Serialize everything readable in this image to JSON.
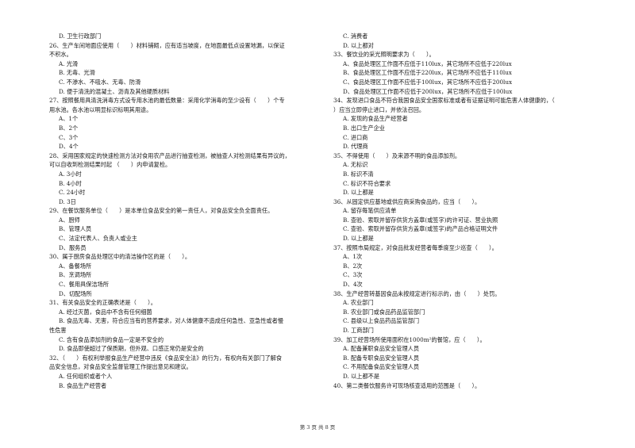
{
  "page": {
    "footer": "第 3 页 共 8 页"
  },
  "left_column": {
    "leading_option": "D. 卫生行政部门",
    "questions": [
      {
        "number": "26",
        "stem_lines": [
          "26、生产车间地面应使用（　　）材料铺砌，应有适当坡度，在地面最低点设置地漏，以保证",
          "不积水。"
        ],
        "options": [
          "A. 光滑",
          "B. 无毒、光滑",
          "C. 不渗水、不吸水、无毒、防滑",
          "D. 便于清洗的混凝土、沥青及其他硬质材料"
        ]
      },
      {
        "number": "27",
        "stem_lines": [
          "27、按照餐用具清洗消毒方式设专用水池的最低数量：采用化学消毒的至少设有（　　）个专",
          "用水池。各水池以明显标识标明其用途。"
        ],
        "options": [
          "A、1个",
          "B、2个",
          "C、3个",
          "D、4个"
        ]
      },
      {
        "number": "28",
        "stem_lines": [
          "28、采用国家规定的快速检测方法对食用农产品进行抽查检测，被抽查人对检测结果有异议的，",
          "可以自收到检测结果时起 （　　）内申请复检。"
        ],
        "options": [
          "A. 3小时",
          "B. 4小时",
          "C. 24小时",
          "D. 3日"
        ]
      },
      {
        "number": "29",
        "stem_lines": [
          "29、在餐饮服务单位（　　）是本单位食品安全的第一责任人，对食品安全负全面责任。"
        ],
        "options": [
          "A、厨师",
          "B、管理人员",
          "C、法定代表人、负责人或业主",
          "D、服务员"
        ]
      },
      {
        "number": "30",
        "stem_lines": [
          "30、属于厨房食品处理区中的清洁操作区的是（　　）。"
        ],
        "options": [
          "A、备餐场所",
          "B、烹调场所",
          "C、餐用具保洁场所",
          "D、切配场所"
        ]
      },
      {
        "number": "31",
        "stem_lines": [
          "31、有关食品安全的正确表述是（　　）。"
        ],
        "options": [
          "A. 经过灭菌，食品中不含有任何细菌",
          "B. 食品无毒、无害，符合应当有的营养要求，对人体健康不造成任何急性、亚急性或者慢|性危害",
          "C. 含有食品添加剂的食品一定是不安全的",
          "D. 食品即使超过了保质期，但外观、口感正常仍是安全的"
        ]
      },
      {
        "number": "32",
        "stem_lines": [
          "32、（　　）有权利举报食品生产经营中违反《食品安全法》的行为，有权向有关部门了解食",
          "品安全信息，对食品安全监督管理工作提出意见和建议。"
        ],
        "options": [
          "A. 任何组织或者个人",
          "B. 食品生产经营者"
        ]
      }
    ]
  },
  "right_column": {
    "leading_options": [
      "C. 消费者",
      "D. 以上都对"
    ],
    "questions": [
      {
        "number": "33",
        "stem_lines": [
          "33、餐饮业的采光照明要求为（　　）。"
        ],
        "options": [
          "A、食品处理区工作面不应低于110lux，其它场所不应低于220lux",
          "B、食品处理区工作面不应低于220lux，其它场所不应低于110lux",
          "C、食品处理区工作面不应低于100lux，其它场所不应低于200lux",
          "D、食品处理区工作面不应低于200lux，其它场所不应低于100lux"
        ]
      },
      {
        "number": "34",
        "stem_lines": [
          "34、发现进口食品不符合我国食品安全国家标准或者有证据证明可能危害人体健康的，（",
          "）应当立即停止进口，并依法召回。"
        ],
        "options": [
          "A. 发现的食品生产经营者",
          "B. 出口生产企业",
          "C. 进口商",
          "D. 代理商"
        ]
      },
      {
        "number": "35",
        "stem_lines": [
          "35、不得使用（　　）及来源不明的食品添加剂。"
        ],
        "options": [
          "A. 无标识",
          "B. 标识不清",
          "C. 标识不符合要求",
          "D. 以上都是"
        ]
      },
      {
        "number": "36",
        "stem_lines": [
          "36、从固定供应基地或供应商采购食品的，应当（　　）。"
        ],
        "options": [
          "A. 留存每笔供应清单",
          "B. 查验、索取并留存供货方盖章(或签字)的许可证、营业执照",
          "C. 查验、索取并留存供货方盖章(或签字)的产品合格证明文件",
          "D. 以上都是"
        ]
      },
      {
        "number": "37",
        "stem_lines": [
          "37、按照市局规定，对食品批发经营者每季度至少巡查（　　）。"
        ],
        "options": [
          "A、1次",
          "B、2次",
          "C、3次",
          "D、4次"
        ]
      },
      {
        "number": "38",
        "stem_lines": [
          "38、生产经营转基因食品未按规定进行标示的，由（　　）处罚。"
        ],
        "options": [
          "A. 农业部门",
          "B. 农业部门或食品药品监管部门",
          "C. 县级以上食品药品监管部门",
          "D. 工商部门"
        ]
      },
      {
        "number": "39",
        "stem_lines": [
          "39、加工经营场所使用面积在1000m²的餐馆，应（　　）。"
        ],
        "options": [
          "A. 配备兼职食品安全管理人员",
          "B. 配备专职食品安全管理人员",
          "C. 不用配备食品安全管理人员",
          "D. 以上都不是"
        ]
      },
      {
        "number": "40",
        "stem_lines": [
          "40、第二类餐饮服务许可现场核查适用的范围是（　　）。"
        ],
        "options": []
      }
    ]
  }
}
